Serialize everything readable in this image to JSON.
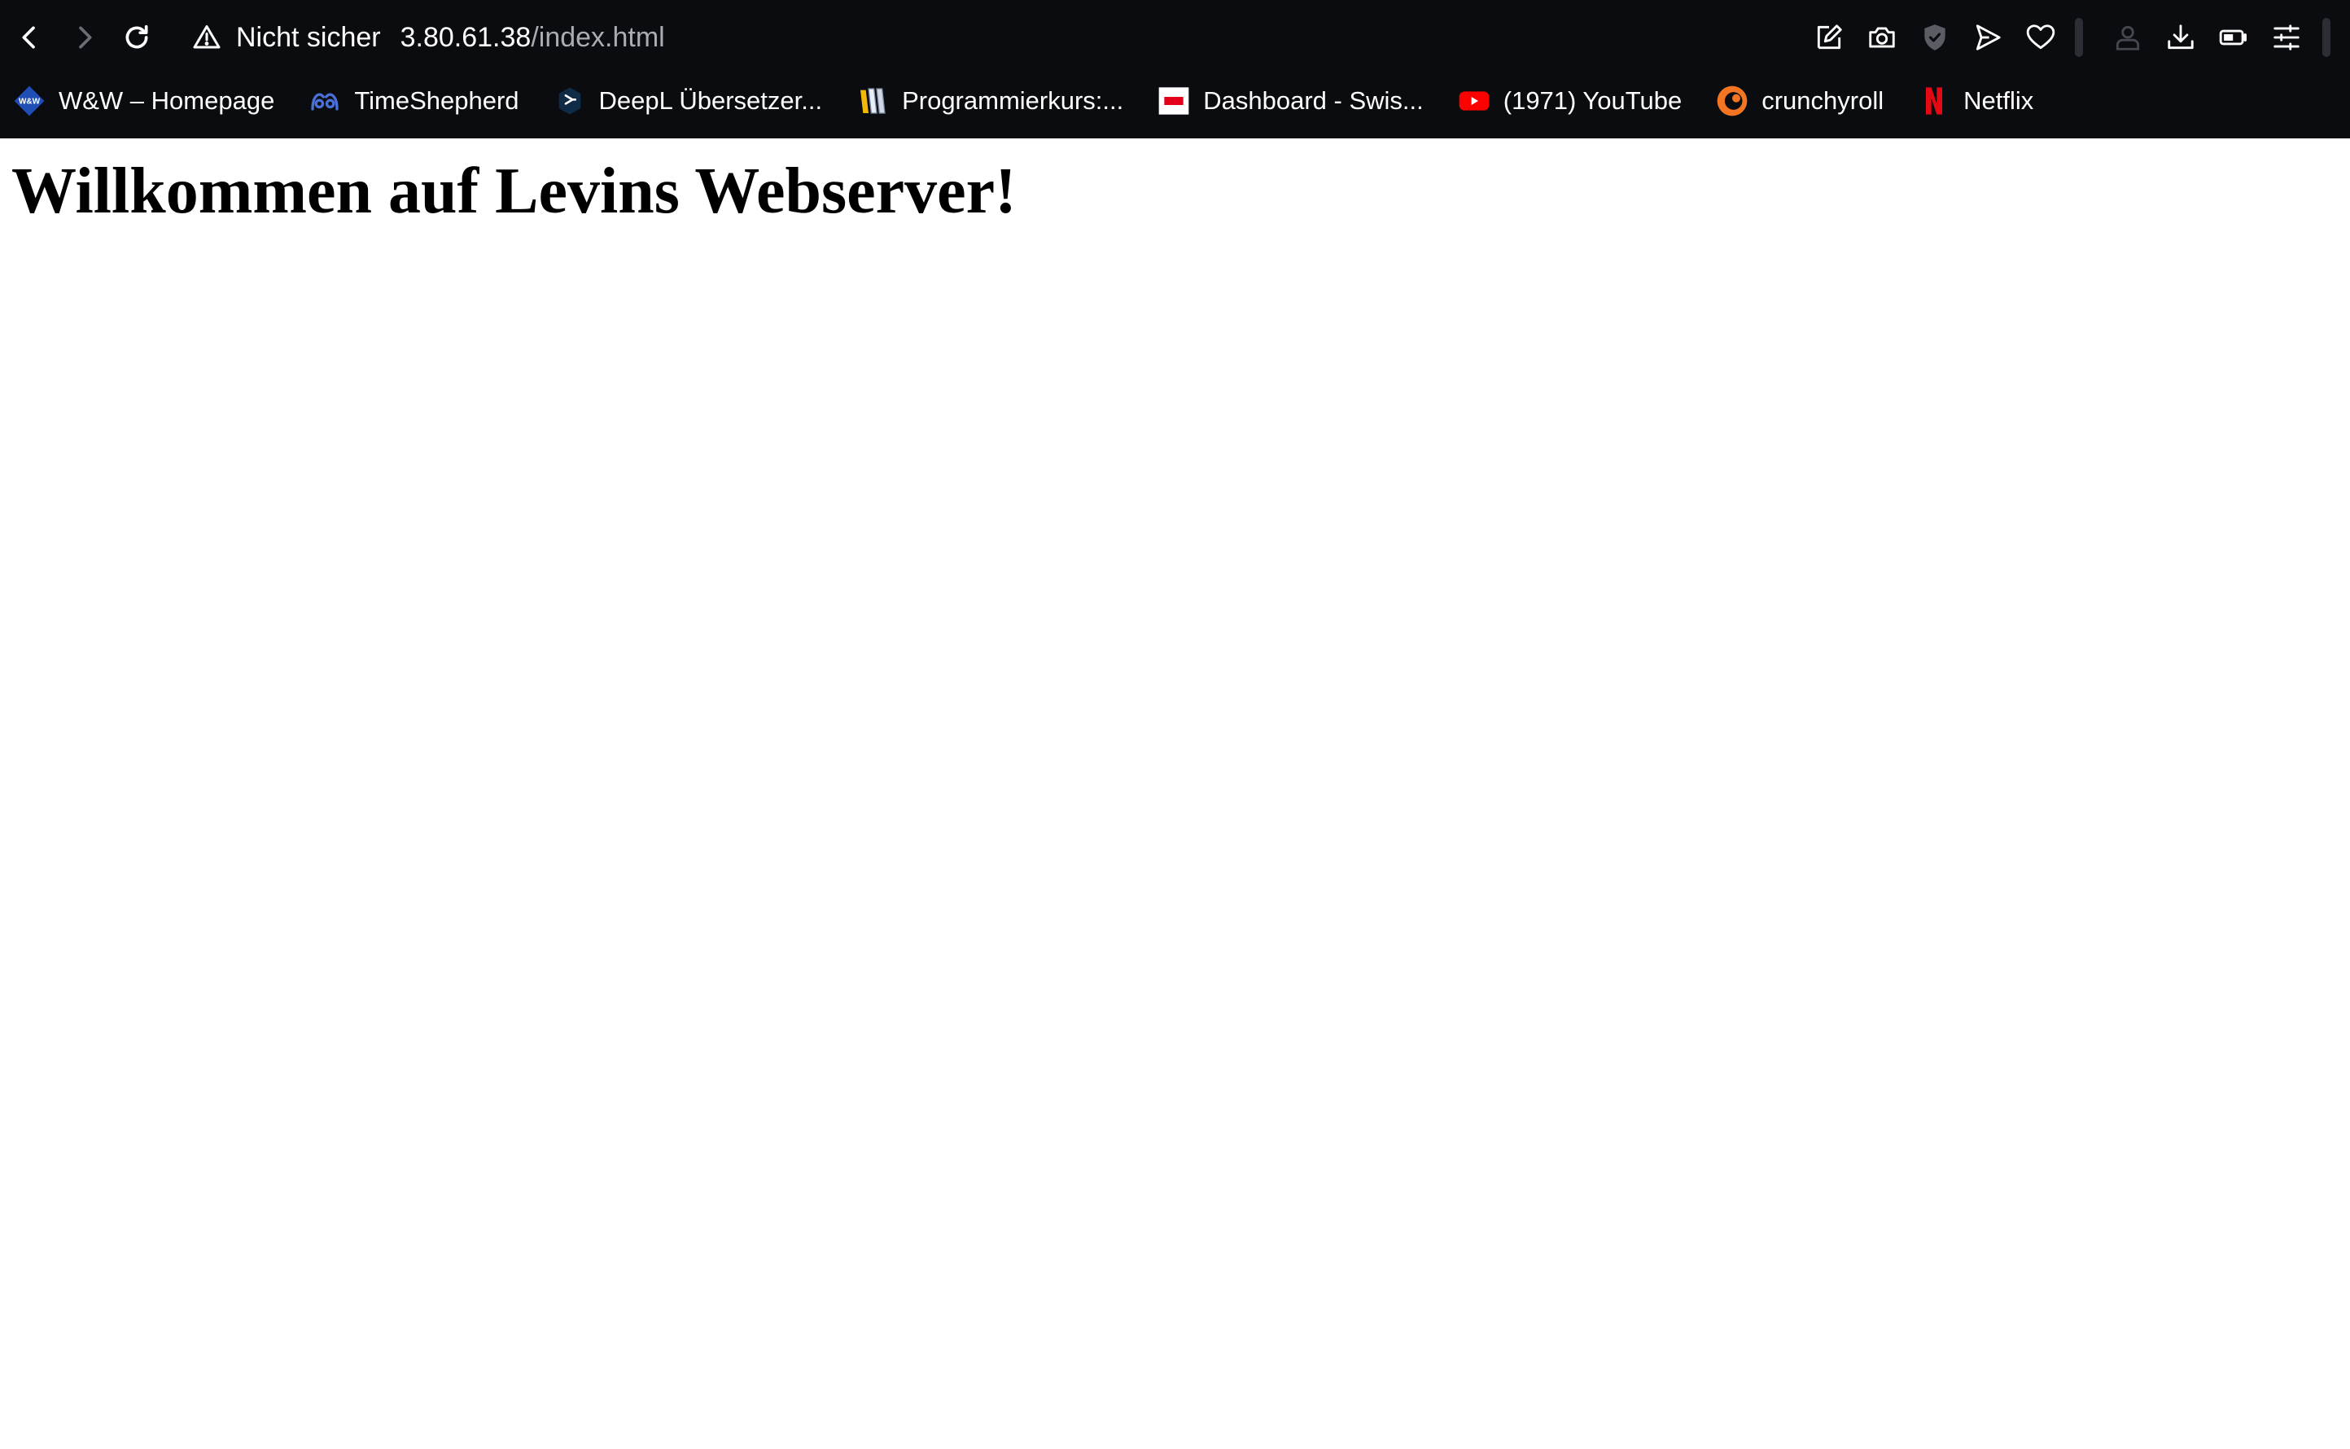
{
  "browser": {
    "security_label": "Nicht sicher",
    "url_host": "3.80.61.38",
    "url_path": "/index.html",
    "toolbar_icons": [
      "edit-icon",
      "camera-icon",
      "shield-icon",
      "send-icon",
      "heart-icon",
      "profile-icon",
      "download-icon",
      "battery-icon",
      "settings-icon"
    ]
  },
  "bookmarks": [
    {
      "label": "W&W – Homepage",
      "icon": "ww-logo-icon",
      "color": "#1f4fb5"
    },
    {
      "label": "TimeShepherd",
      "icon": "timeshepherd-icon",
      "color": "#4a6fd6"
    },
    {
      "label": "DeepL Übersetzer...",
      "icon": "deepl-icon",
      "color": "#0f2b46"
    },
    {
      "label": "Programmierkurs:...",
      "icon": "programmierkurs-icon",
      "color": "#f2b807"
    },
    {
      "label": "Dashboard - Swis...",
      "icon": "dashboard-icon",
      "color": "#e2001a"
    },
    {
      "label": "(1971) YouTube",
      "icon": "youtube-icon",
      "color": "#ff0000"
    },
    {
      "label": "crunchyroll",
      "icon": "crunchyroll-icon",
      "color": "#f47521"
    },
    {
      "label": "Netflix",
      "icon": "netflix-icon",
      "color": "#e50914"
    }
  ],
  "page": {
    "title": "Willkommen auf Levins Webserver!"
  }
}
